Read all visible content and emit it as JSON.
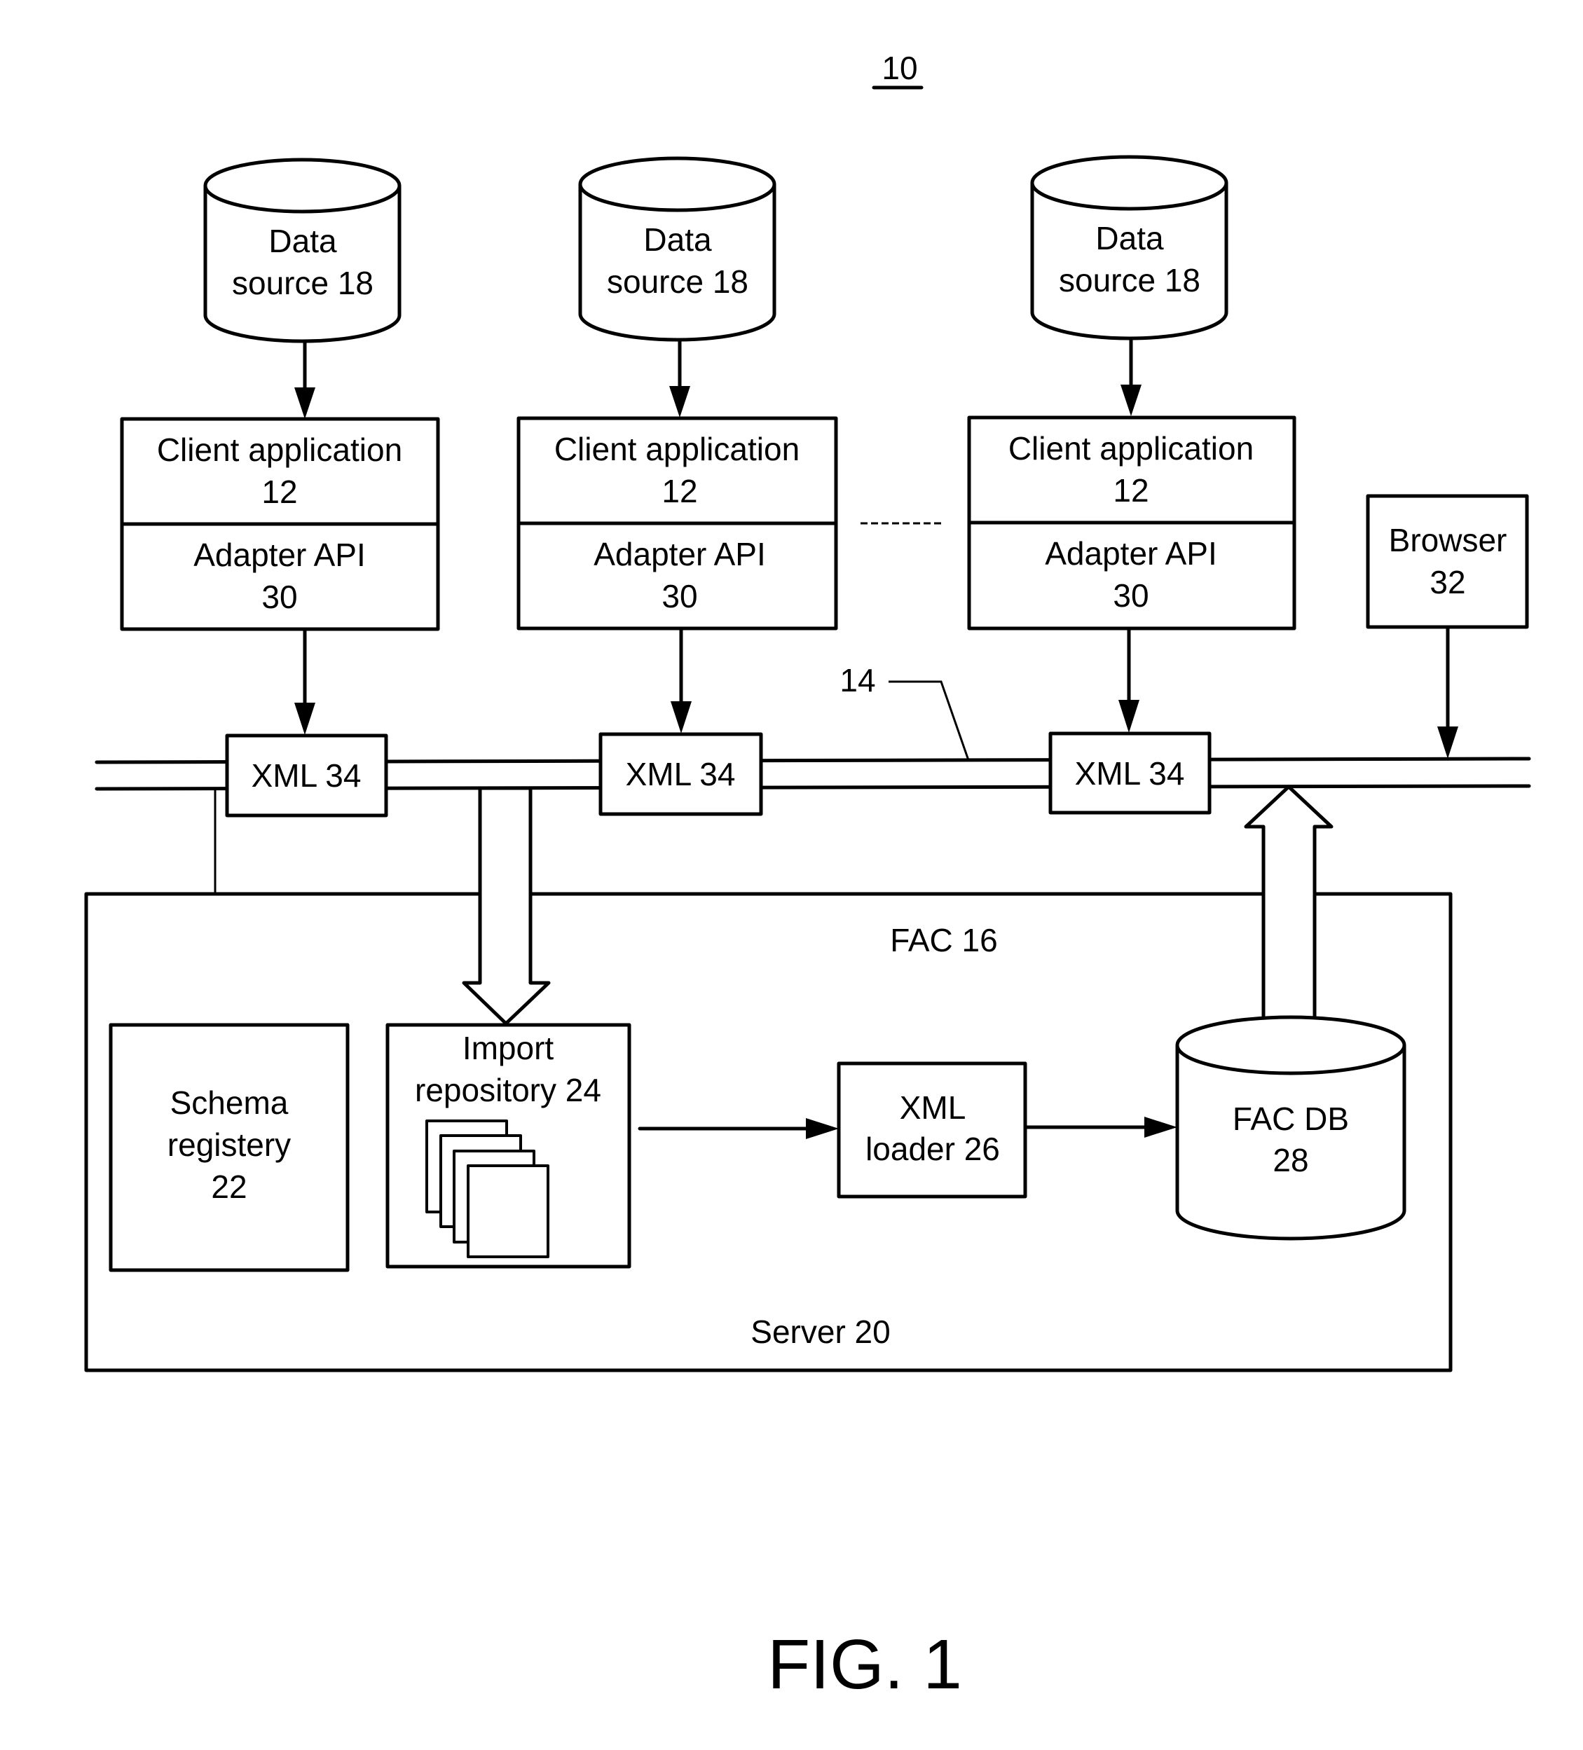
{
  "figure": {
    "reference_number": "10",
    "caption": "FIG. 1"
  },
  "data_sources": [
    {
      "line1": "Data",
      "line2": "source 18"
    },
    {
      "line1": "Data",
      "line2": "source 18"
    },
    {
      "line1": "Data",
      "line2": "source 18"
    }
  ],
  "client_stacks": [
    {
      "client_line1": "Client application",
      "client_line2": "12",
      "adapter_line1": "Adapter API",
      "adapter_line2": "30"
    },
    {
      "client_line1": "Client application",
      "client_line2": "12",
      "adapter_line1": "Adapter API",
      "adapter_line2": "30"
    },
    {
      "client_line1": "Client application",
      "client_line2": "12",
      "adapter_line1": "Adapter API",
      "adapter_line2": "30"
    }
  ],
  "browser": {
    "line1": "Browser",
    "line2": "32"
  },
  "network": {
    "label": "14"
  },
  "xml_messages": [
    {
      "label": "XML 34"
    },
    {
      "label": "XML 34"
    },
    {
      "label": "XML 34"
    }
  ],
  "server": {
    "fac_label": "FAC 16",
    "server_label": "Server 20",
    "schema_registry": {
      "line1": "Schema",
      "line2": "registery",
      "line3": "22"
    },
    "import_repository": {
      "line1": "Import",
      "line2": "repository 24"
    },
    "xml_loader": {
      "line1": "XML",
      "line2": "loader 26"
    },
    "fac_db": {
      "line1": "FAC DB",
      "line2": "28"
    }
  }
}
